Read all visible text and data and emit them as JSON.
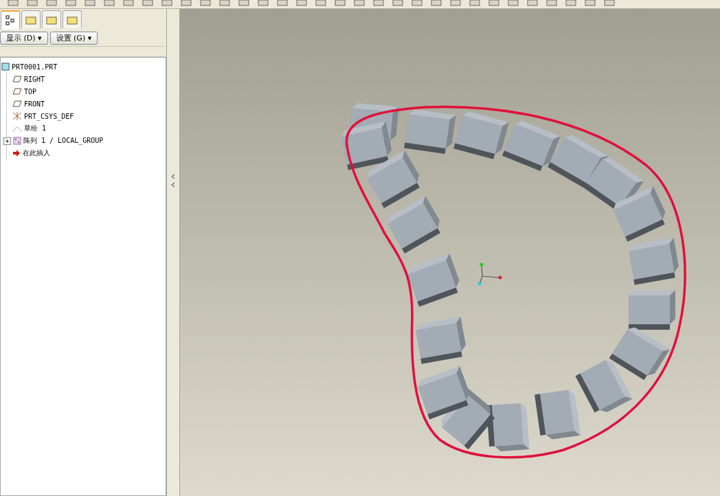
{
  "panel_tabs": [
    {
      "selected": true
    },
    {
      "selected": false
    },
    {
      "selected": false
    },
    {
      "selected": false
    }
  ],
  "menus": [
    {
      "label": "显示 (D) ▾"
    },
    {
      "label": "设置 (G) ▾"
    }
  ],
  "model_tree": {
    "label": "PRT0001.PRT",
    "kind": "part",
    "children": [
      {
        "label": "RIGHT",
        "kind": "plane"
      },
      {
        "label": "TOP",
        "kind": "plane"
      },
      {
        "label": "FRONT",
        "kind": "plane"
      },
      {
        "label": "PRT_CSYS_DEF",
        "kind": "csys"
      },
      {
        "label": "草绘 1",
        "kind": "sketch"
      },
      {
        "label": "阵列 1 / LOCAL_GROUP",
        "kind": "pattern",
        "expanded": false
      },
      {
        "label": "在此插入",
        "kind": "insert"
      }
    ]
  }
}
